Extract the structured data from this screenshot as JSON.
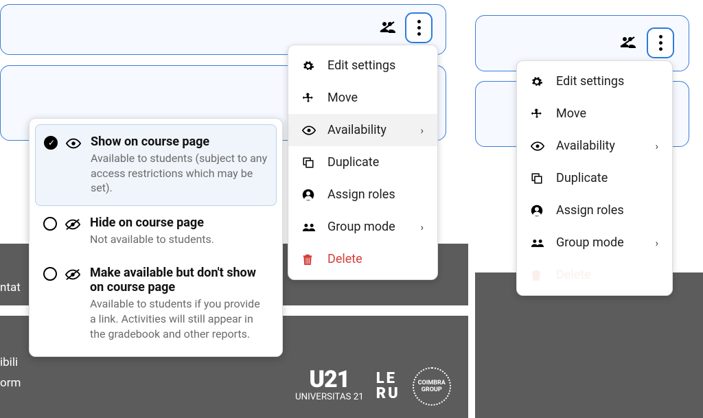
{
  "menu": {
    "edit_settings": "Edit settings",
    "move": "Move",
    "availability": "Availability",
    "duplicate": "Duplicate",
    "assign_roles": "Assign roles",
    "group_mode": "Group mode",
    "delete": "Delete"
  },
  "availability_options": [
    {
      "title": "Show on course page",
      "desc": "Available to students (subject to any access restrictions which may be set).",
      "selected": true
    },
    {
      "title": "Hide on course page",
      "desc": "Not available to students.",
      "selected": false
    },
    {
      "title": "Make available but don't show on course page",
      "desc": "Available to students if you provide a link. Activities will still appear in the gradebook and other reports.",
      "selected": false
    }
  ],
  "footer": {
    "left_fragment_1": "ntat",
    "left_fragment_2": "ibili",
    "left_fragment_3": "orm",
    "logo_u21": "U21",
    "logo_u21_sub": "UNIVERSITAS 21",
    "logo_leru_1": "LE",
    "logo_leru_2": "RU",
    "logo_cg_1": "COIMBRA",
    "logo_cg_2": "GROUP"
  }
}
